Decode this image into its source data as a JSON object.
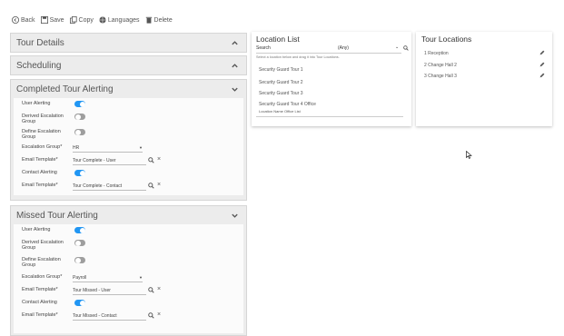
{
  "toolbar": {
    "back": "Back",
    "save": "Save",
    "copy": "Copy",
    "languages": "Languages",
    "delete": "Delete"
  },
  "sections": {
    "tour_details": "Tour Details",
    "scheduling": "Scheduling",
    "completed": {
      "title": "Completed Tour Alerting",
      "user_alerting": "User Alerting",
      "derived_escalation": "Derived Escalation Group",
      "define_escalation": "Define Escalation Group",
      "escalation_group_label": "Escalation Group*",
      "escalation_group_value": "HR",
      "email_template_label": "Email Template*",
      "email_template_user": "Tour Complete - User",
      "contact_alerting": "Contact Alerting",
      "email_template_contact": "Tour Complete - Contact"
    },
    "missed": {
      "title": "Missed Tour Alerting",
      "user_alerting": "User Alerting",
      "derived_escalation": "Derived Escalation Group",
      "define_escalation": "Define Escalation Group",
      "escalation_group_label": "Escalation Group*",
      "escalation_group_value": "Payroll",
      "email_template_label": "Email Template*",
      "email_template_user": "Tour Missed - User",
      "contact_alerting": "Contact Alerting",
      "email_template_contact": "Tour Missed - Contact"
    }
  },
  "location_list": {
    "title": "Location List",
    "search_label": "Search",
    "search_value": "(Any)",
    "hint": "Select a location below and drag it into Tour Locations.",
    "items": [
      "Security Guard Tour 1",
      "Security Guard Tour 2",
      "Security Guard Tour 3",
      "Security Guard Tour 4 Office",
      "Location Name Office List"
    ]
  },
  "tour_locations": {
    "title": "Tour Locations",
    "items": [
      "1  Reception",
      "2  Change Hall 2",
      "3  Change Hall 3"
    ]
  },
  "colors": {
    "toggle_on": "#2196f3",
    "toggle_off": "#9e9e9e",
    "section_bg": "#ececec"
  }
}
